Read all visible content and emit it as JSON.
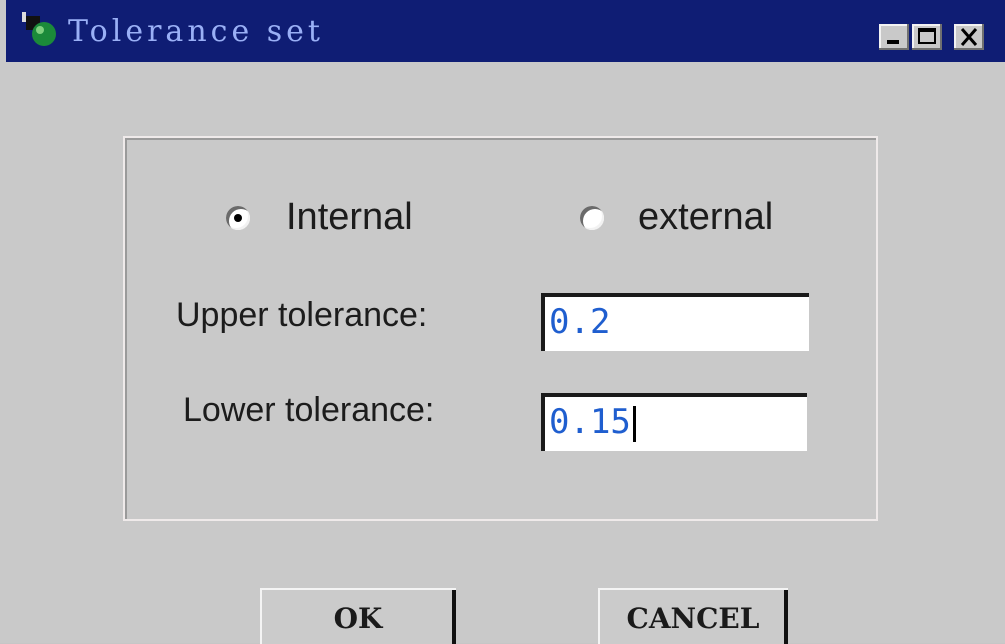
{
  "window": {
    "title": "Tolerance set",
    "icon": "app-icon"
  },
  "title_buttons": {
    "minimize_icon": "minimize-icon",
    "maximize_icon": "maximize-icon",
    "close_icon": "close-icon"
  },
  "radio": {
    "internal_label": "Internal",
    "external_label": "external",
    "selected": "internal"
  },
  "fields": {
    "upper_label": "Upper tolerance:",
    "upper_value": "0.2",
    "lower_label": "Lower tolerance:",
    "lower_value": "0.15"
  },
  "buttons": {
    "ok_label": "OK",
    "cancel_label": "CANCEL"
  },
  "colors": {
    "titlebar": "#0f1d74",
    "title_text": "#9ab0f6",
    "field_text": "#1f5ecf",
    "window_bg": "#c9c9c9"
  }
}
